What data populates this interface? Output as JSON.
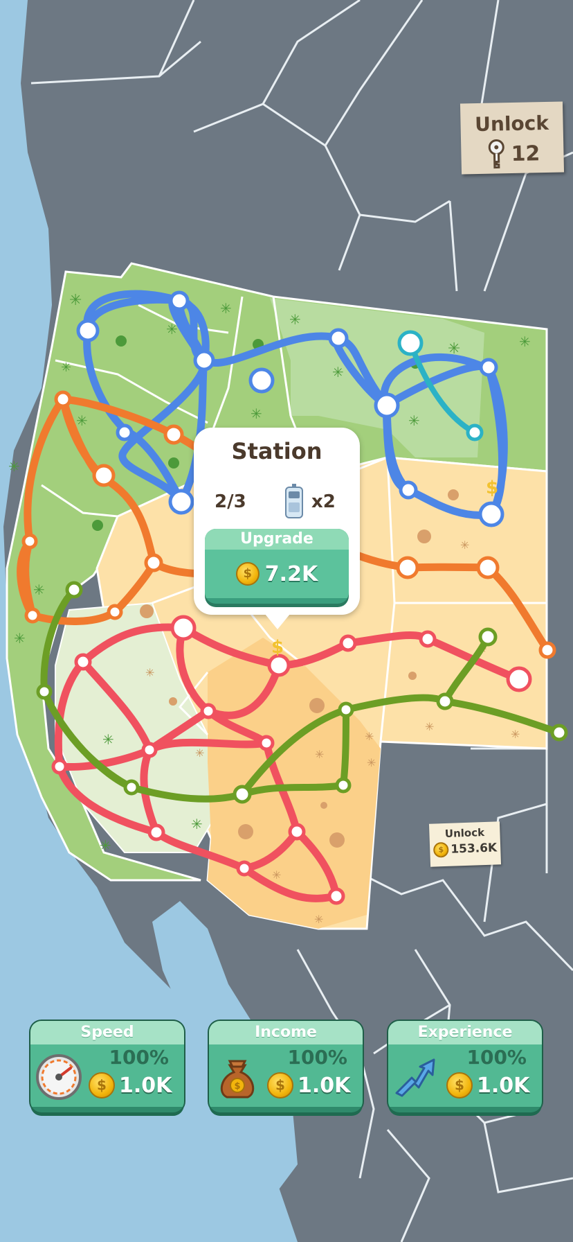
{
  "unlock_keys": {
    "label": "Unlock",
    "count": "12",
    "icon": "key-icon"
  },
  "unlock_region": {
    "label": "Unlock",
    "price": "153.6K",
    "icon": "coin-icon"
  },
  "station_popup": {
    "title": "Station",
    "capacity": "2/3",
    "train_multiplier": "x2",
    "train_icon": "train-icon",
    "upgrade": {
      "label": "Upgrade",
      "price": "7.2K",
      "icon": "coin-icon"
    }
  },
  "upgrades": [
    {
      "label": "Speed",
      "percent": "100%",
      "price": "1.0K",
      "icon": "speedometer-icon"
    },
    {
      "label": "Income",
      "percent": "100%",
      "price": "1.0K",
      "icon": "money-bag-icon"
    },
    {
      "label": "Experience",
      "percent": "100%",
      "price": "1.0K",
      "icon": "arrows-up-icon"
    }
  ],
  "line_colors": {
    "blue": "#4d86e6",
    "teal": "#2bb2c6",
    "orange": "#f07a2e",
    "red": "#f0515f",
    "olive": "#6c9e25"
  }
}
